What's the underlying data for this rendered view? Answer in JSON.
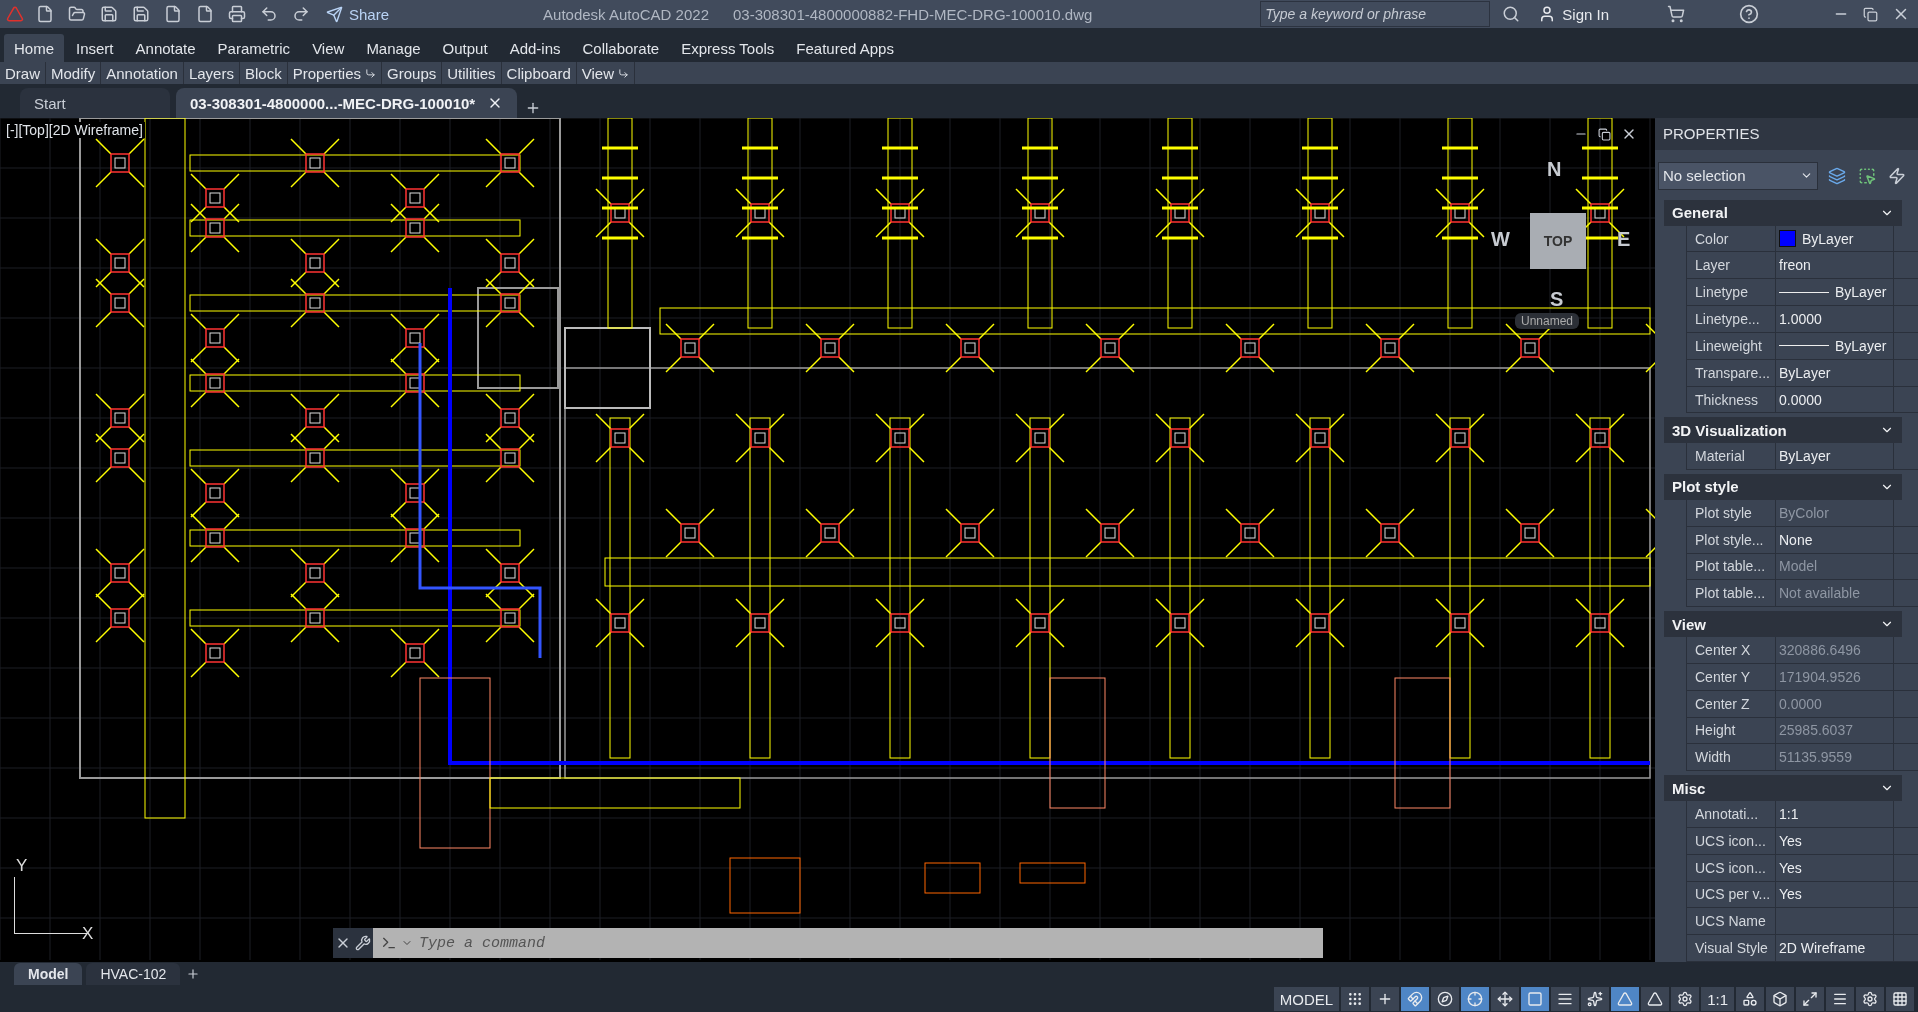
{
  "title_bar": {
    "share": "Share",
    "app": "Autodesk AutoCAD 2022",
    "file": "03-308301-4800000882-FHD-MEC-DRG-100010.dwg",
    "search": {
      "placeholder": "Type a keyword or phrase"
    },
    "sign_in": "Sign In"
  },
  "ribbon_tabs": [
    {
      "label": "Home",
      "selected": true
    },
    {
      "label": "Insert",
      "selected": false
    },
    {
      "label": "Annotate",
      "selected": false
    },
    {
      "label": "Parametric",
      "selected": false
    },
    {
      "label": "View",
      "selected": false
    },
    {
      "label": "Manage",
      "selected": false
    },
    {
      "label": "Output",
      "selected": false
    },
    {
      "label": "Add-ins",
      "selected": false
    },
    {
      "label": "Collaborate",
      "selected": false
    },
    {
      "label": "Express Tools",
      "selected": false
    },
    {
      "label": "Featured Apps",
      "selected": false
    }
  ],
  "ribbon_panels": [
    {
      "label": "Draw",
      "launcher": false
    },
    {
      "label": "Modify",
      "launcher": false
    },
    {
      "label": "Annotation",
      "launcher": false
    },
    {
      "label": "Layers",
      "launcher": false
    },
    {
      "label": "Block",
      "launcher": false
    },
    {
      "label": "Properties",
      "launcher": true
    },
    {
      "label": "Groups",
      "launcher": false
    },
    {
      "label": "Utilities",
      "launcher": false
    },
    {
      "label": "Clipboard",
      "launcher": false
    },
    {
      "label": "View",
      "launcher": true
    }
  ],
  "file_tabs": [
    {
      "label": "Start",
      "selected": false
    },
    {
      "label": "03-308301-4800000...-MEC-DRG-100010*",
      "selected": true
    }
  ],
  "viewport": {
    "label": "[-][Top][2D Wireframe]",
    "viewcube": {
      "n": "N",
      "w": "W",
      "e": "E",
      "s": "S",
      "face": "TOP",
      "ucs": "Unnamed"
    },
    "ucs_y": "Y",
    "ucs_x": "X"
  },
  "command_line": {
    "placeholder": "Type a command"
  },
  "properties": {
    "title": "PROPERTIES",
    "selection": "No selection",
    "sections": [
      {
        "title": "General",
        "expanded": true,
        "rows": [
          {
            "label": "Color",
            "value": "ByLayer",
            "kind": "color",
            "color": "#0000ff",
            "disabled": false
          },
          {
            "label": "Layer",
            "value": "freon",
            "kind": "text",
            "disabled": false
          },
          {
            "label": "Linetype",
            "value": "ByLayer",
            "kind": "line",
            "disabled": false
          },
          {
            "label": "Linetype...",
            "value": "1.0000",
            "kind": "text",
            "disabled": false
          },
          {
            "label": "Lineweight",
            "value": "ByLayer",
            "kind": "line",
            "disabled": false
          },
          {
            "label": "Transpare...",
            "value": "ByLayer",
            "kind": "text",
            "disabled": false
          },
          {
            "label": "Thickness",
            "value": "0.0000",
            "kind": "text",
            "disabled": false
          }
        ]
      },
      {
        "title": "3D Visualization",
        "expanded": true,
        "rows": [
          {
            "label": "Material",
            "value": "ByLayer",
            "kind": "text",
            "disabled": false
          }
        ]
      },
      {
        "title": "Plot style",
        "expanded": true,
        "rows": [
          {
            "label": "Plot style",
            "value": "ByColor",
            "kind": "text",
            "disabled": true
          },
          {
            "label": "Plot style...",
            "value": "None",
            "kind": "text",
            "disabled": false
          },
          {
            "label": "Plot table...",
            "value": "Model",
            "kind": "text",
            "disabled": true
          },
          {
            "label": "Plot table...",
            "value": "Not available",
            "kind": "text",
            "disabled": true
          }
        ]
      },
      {
        "title": "View",
        "expanded": true,
        "rows": [
          {
            "label": "Center X",
            "value": "320886.6496",
            "kind": "text",
            "disabled": true
          },
          {
            "label": "Center Y",
            "value": "171904.9526",
            "kind": "text",
            "disabled": true
          },
          {
            "label": "Center Z",
            "value": "0.0000",
            "kind": "text",
            "disabled": true
          },
          {
            "label": "Height",
            "value": "25985.6037",
            "kind": "text",
            "disabled": true
          },
          {
            "label": "Width",
            "value": "51135.9559",
            "kind": "text",
            "disabled": true
          }
        ]
      },
      {
        "title": "Misc",
        "expanded": true,
        "rows": [
          {
            "label": "Annotati...",
            "value": "1:1",
            "kind": "text",
            "disabled": false
          },
          {
            "label": "UCS icon...",
            "value": "Yes",
            "kind": "text",
            "disabled": false
          },
          {
            "label": "UCS icon...",
            "value": "Yes",
            "kind": "text",
            "disabled": false
          },
          {
            "label": "UCS per v...",
            "value": "Yes",
            "kind": "text",
            "disabled": false
          },
          {
            "label": "UCS Name",
            "value": "",
            "kind": "text",
            "disabled": false
          },
          {
            "label": "Visual Style",
            "value": "2D Wireframe",
            "kind": "text",
            "disabled": false
          }
        ]
      }
    ]
  },
  "layout_tabs": [
    {
      "label": "Model",
      "selected": true
    },
    {
      "label": "HVAC-102",
      "selected": false
    }
  ],
  "status_bar": [
    {
      "kind": "text",
      "label": "MODEL"
    },
    {
      "kind": "icon",
      "on": false
    },
    {
      "kind": "icon",
      "on": false
    },
    {
      "kind": "icon",
      "on": true
    },
    {
      "kind": "icon",
      "on": false
    },
    {
      "kind": "icon",
      "on": true
    },
    {
      "kind": "icon",
      "on": false
    },
    {
      "kind": "icon",
      "on": true
    },
    {
      "kind": "icon",
      "on": false
    },
    {
      "kind": "icon",
      "on": false
    },
    {
      "kind": "icon",
      "on": true
    },
    {
      "kind": "icon",
      "on": false
    },
    {
      "kind": "icon",
      "on": false
    },
    {
      "kind": "text",
      "label": "1:1"
    },
    {
      "kind": "icon",
      "on": false
    },
    {
      "kind": "icon",
      "on": false
    },
    {
      "kind": "icon",
      "on": false
    },
    {
      "kind": "icon",
      "on": false
    },
    {
      "kind": "icon",
      "on": false
    },
    {
      "kind": "icon",
      "on": false
    }
  ]
}
